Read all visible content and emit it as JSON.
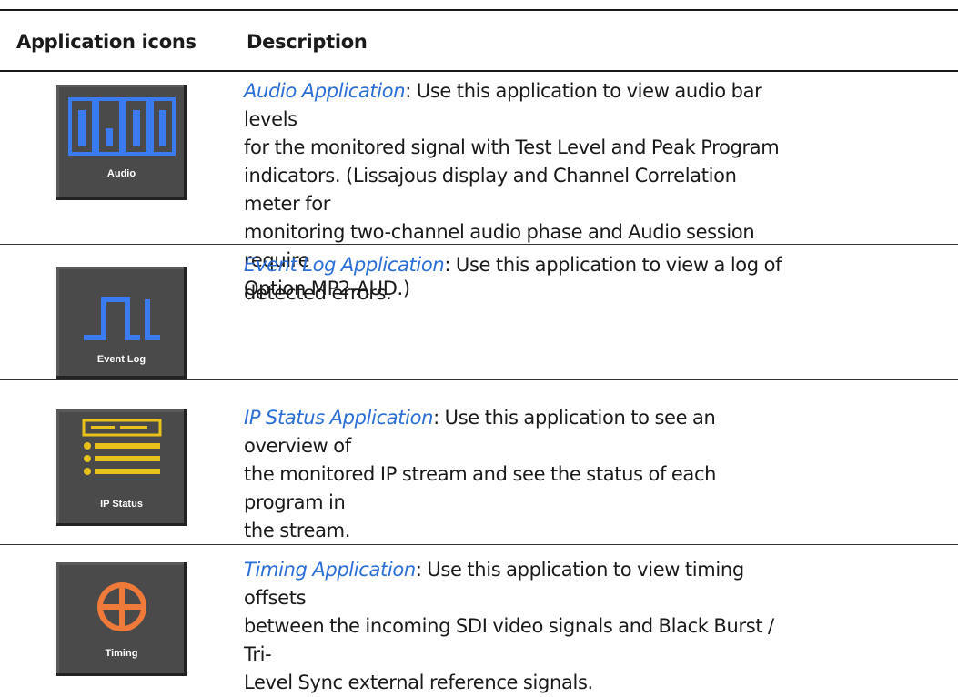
{
  "header": {
    "col_icons": "Application icons",
    "col_description": "Description"
  },
  "rows": [
    {
      "icon_name": "audio-icon",
      "icon_label": "Audio",
      "icon_color": "#3a7bf0",
      "link": "Audio Application",
      "text_lines": [
        ": Use this application to view audio bar levels",
        "for the monitored signal with Test Level and Peak Program",
        "indicators. (Lissajous display and Channel Correlation meter for",
        "monitoring two-channel audio phase and Audio session require",
        "Option MP2-AUD.)"
      ]
    },
    {
      "icon_name": "event-log-icon",
      "icon_label": "Event Log",
      "icon_color": "#3a7bf0",
      "link": "Event Log Application",
      "text_lines": [
        ": Use this application to view a log of",
        "detected errors."
      ]
    },
    {
      "icon_name": "ip-status-icon",
      "icon_label": "IP Status",
      "icon_color": "#e8c21a",
      "link": "IP Status Application",
      "text_lines": [
        ": Use this application to see an overview of",
        "the monitored IP stream and see the status of each program in",
        "the stream."
      ]
    },
    {
      "icon_name": "timing-icon",
      "icon_label": "Timing",
      "icon_color": "#f07a3a",
      "link": "Timing Application",
      "text_lines": [
        ": Use this application to view timing offsets",
        "between the incoming SDI video signals and Black Burst / Tri-",
        "Level Sync external reference signals."
      ]
    }
  ]
}
